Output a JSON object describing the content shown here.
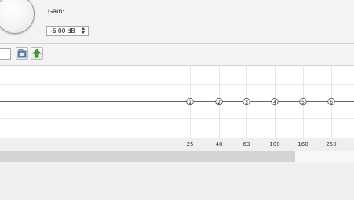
{
  "gain": {
    "label": "Gain:",
    "value": "-6.00 dB"
  },
  "eq_graph": {
    "bands": [
      {
        "id": "1",
        "freq": "25"
      },
      {
        "id": "2",
        "freq": "40"
      },
      {
        "id": "3",
        "freq": "63"
      },
      {
        "id": "4",
        "freq": "100"
      },
      {
        "id": "5",
        "freq": "160"
      },
      {
        "id": "6",
        "freq": "250"
      }
    ]
  },
  "icons": {
    "open": "folder-open-icon",
    "upload": "green-up-arrow-icon"
  },
  "colors": {
    "curve": "#666666",
    "grid": "#e6e6e6",
    "thumb": "#d4d4d4",
    "upload": "#3aa32c"
  }
}
